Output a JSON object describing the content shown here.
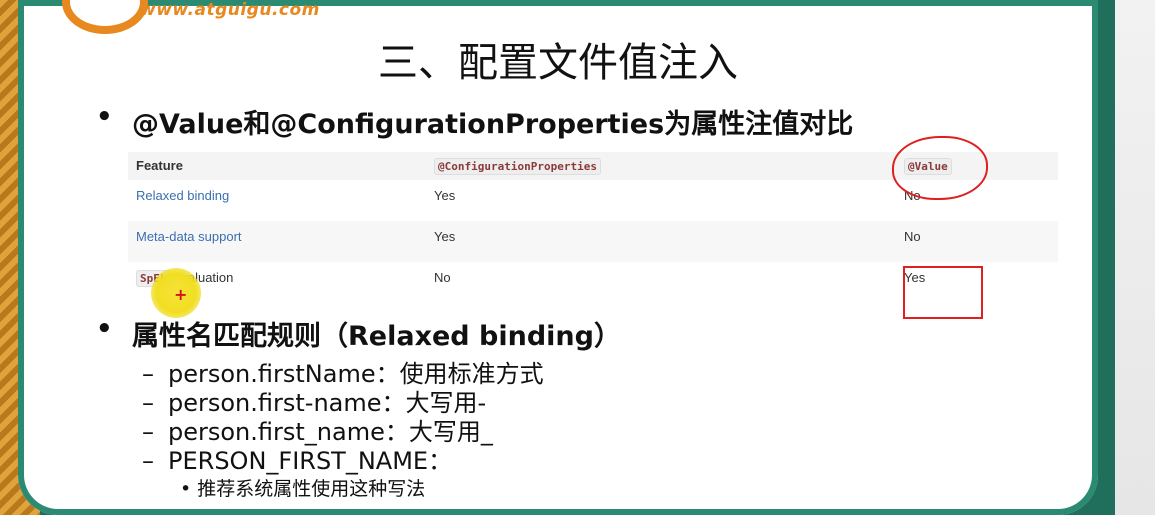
{
  "logo": {
    "site": "www.atguigu.com"
  },
  "slide": {
    "title": "三、配置文件值注入",
    "bullet1": "@Value和@ConfigurationProperties为属性注值对比",
    "bullet2": "属性名匹配规则（Relaxed binding）",
    "rules": [
      "person.firstName：使用标准方式",
      "person.first-name：大写用-",
      "person.first_name：大写用_",
      "PERSON_FIRST_NAME："
    ],
    "subrule": "推荐系统属性使用这种写法"
  },
  "table": {
    "headers": [
      "Feature",
      "@ConfigurationProperties",
      "@Value"
    ],
    "rows": [
      {
        "feature": "Relaxed binding",
        "cp": "Yes",
        "value": "No"
      },
      {
        "feature": "Meta-data support",
        "cp": "Yes",
        "value": "No"
      },
      {
        "feature_code": "SpEL",
        "feature_suffix": " evaluation",
        "cp": "No",
        "value": "Yes"
      }
    ]
  },
  "annotations": {
    "cursor": "+",
    "color": "#e02020"
  },
  "colors": {
    "frame": "#1f6f5c",
    "accent": "#e7891f",
    "link": "#3b6fb0"
  },
  "symbols": {
    "dash": "–",
    "dot": "•"
  }
}
